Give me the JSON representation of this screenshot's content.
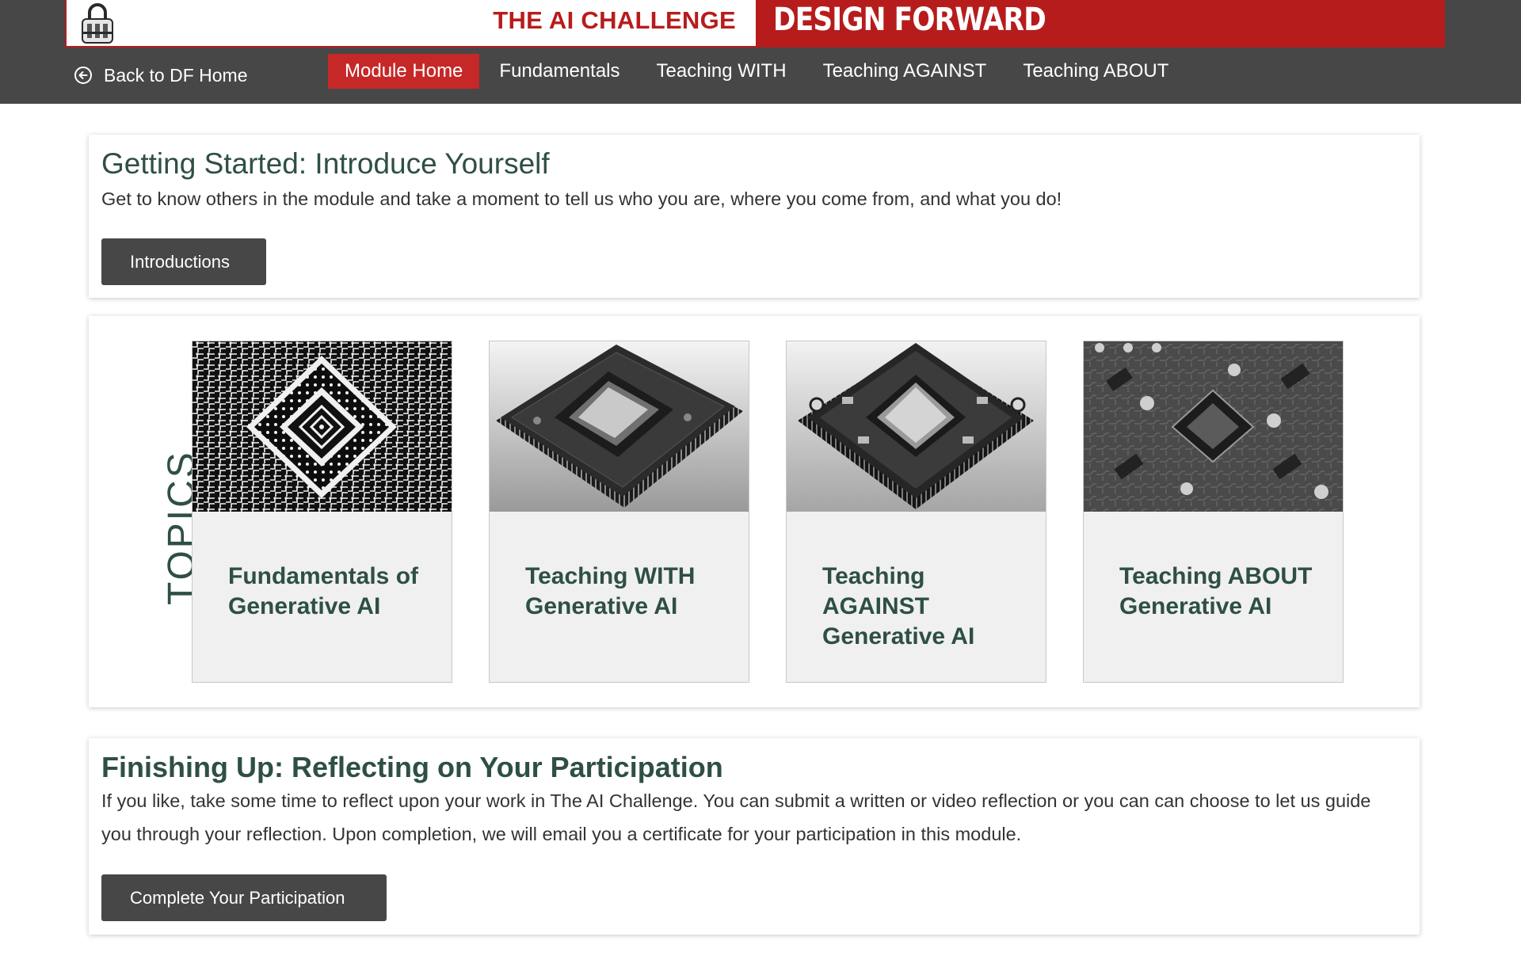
{
  "header": {
    "challenge_title": "THE AI CHALLENGE",
    "brand_title": "DESIGN FORWARD",
    "brand_color": "#b71c1c",
    "back_link": "Back to DF Home",
    "logo_icon": "lock-icon",
    "back_icon": "arrow-circle-left-icon"
  },
  "nav": {
    "items": [
      {
        "label": "Module Home",
        "active": true
      },
      {
        "label": "Fundamentals"
      },
      {
        "label": "Teaching WITH"
      },
      {
        "label": "Teaching AGAINST"
      },
      {
        "label": "Teaching ABOUT"
      }
    ]
  },
  "intro": {
    "title": "Getting Started: Introduce Yourself",
    "text": "Get to know others in the module and take a moment to tell us who you are, where you come from, and what you do!",
    "button": "Introductions"
  },
  "topics": {
    "label": "TOPICS",
    "tiles": [
      {
        "label": "Fundamentals of Generative AI"
      },
      {
        "label": "Teaching WITH Generative AI"
      },
      {
        "label": "Teaching AGAINST Generative AI"
      },
      {
        "label": "Teaching ABOUT Generative AI"
      }
    ]
  },
  "finish": {
    "title": "Finishing Up: Reflecting on Your Participation",
    "text": "If you like, take some time to reflect upon your work in The AI Challenge. You can submit a written or video reflection or you can can choose to let us guide you through your reflection. Upon completion, we will email you a certificate for your participation in this module.",
    "button": "Complete Your Participation"
  },
  "colors": {
    "heading": "#2e4f45",
    "dark_bar": "#474747",
    "nav_active": "#c62828"
  }
}
